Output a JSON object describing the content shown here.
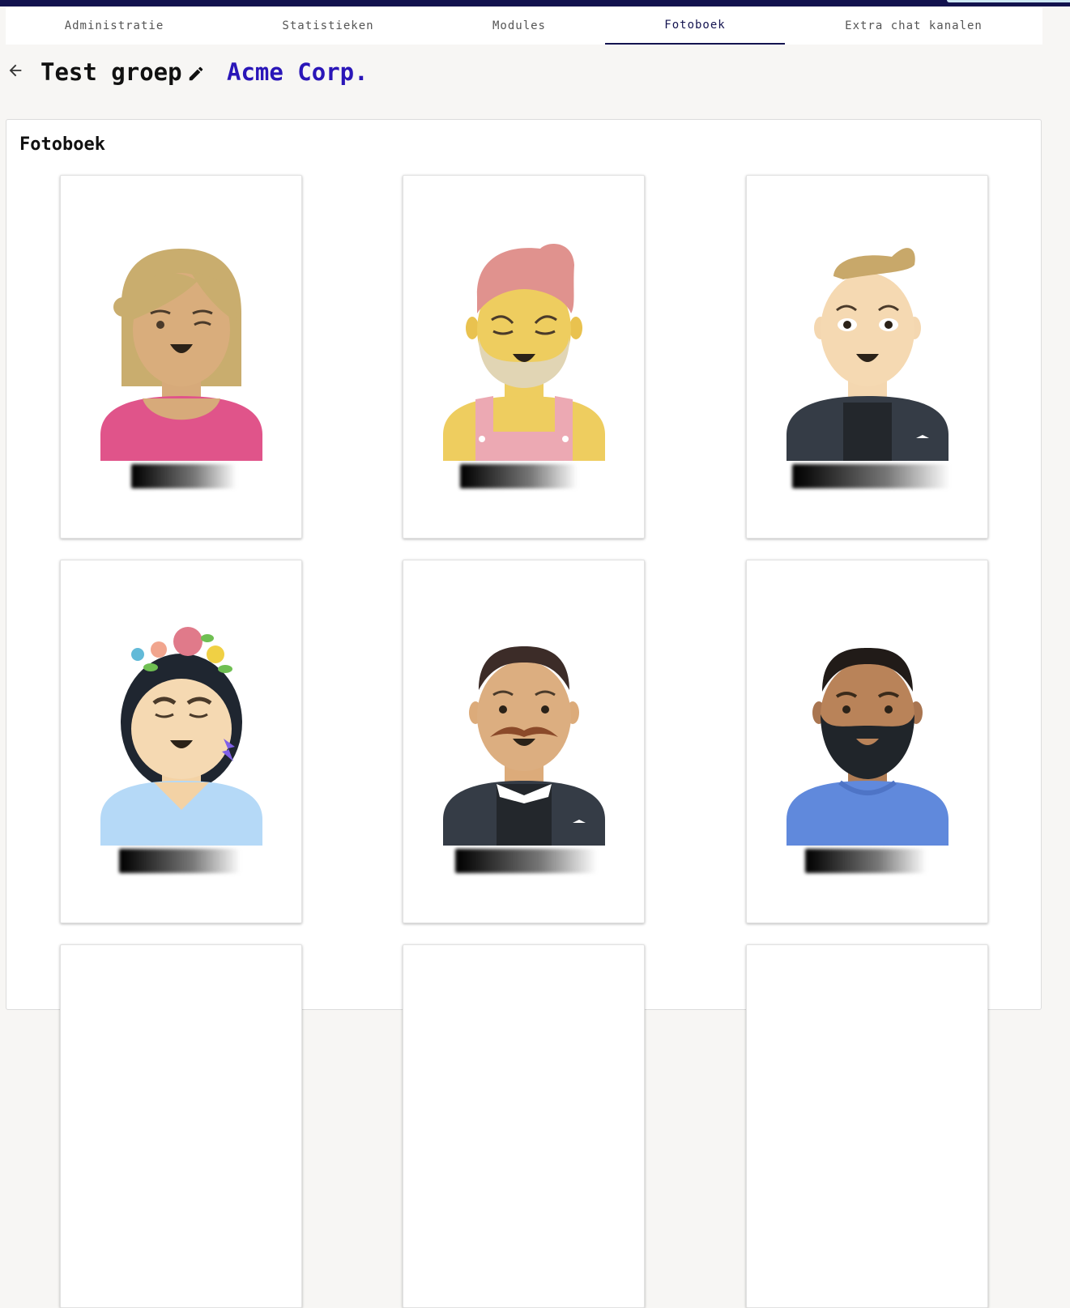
{
  "nav": {
    "tabs": [
      {
        "label": "Administratie"
      },
      {
        "label": "Statistieken"
      },
      {
        "label": "Modules"
      },
      {
        "label": "Fotoboek"
      },
      {
        "label": "Extra chat kanalen"
      }
    ],
    "active_tab": "Fotoboek"
  },
  "header": {
    "group_name": "Test groep",
    "organization": "Acme Corp."
  },
  "gallery": {
    "title": "Fotoboek",
    "members": [
      {
        "avatar": "woman-blonde-winking-avatar"
      },
      {
        "avatar": "man-pink-hair-beard-overalls-avatar"
      },
      {
        "avatar": "man-blond-quiff-suit-avatar"
      },
      {
        "avatar": "woman-flower-crown-avatar"
      },
      {
        "avatar": "man-mustache-suit-avatar"
      },
      {
        "avatar": "man-beard-blue-shirt-avatar"
      }
    ]
  },
  "colors": {
    "topbar": "#12124e",
    "accent_link": "#2a16b8",
    "background": "#f7f6f4"
  }
}
